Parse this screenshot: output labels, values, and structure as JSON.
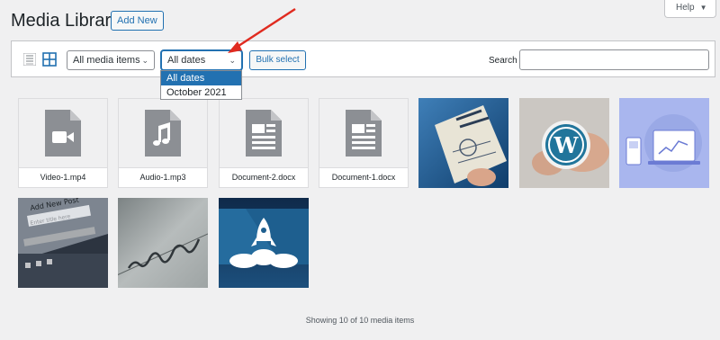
{
  "header": {
    "title": "Media Library",
    "add_new_label": "Add New",
    "help_label": "Help"
  },
  "toolbar": {
    "media_filter": "All media items",
    "date_filter": "All dates",
    "bulk_select_label": "Bulk select",
    "search_label": "Search",
    "search_value": ""
  },
  "date_dropdown": {
    "options": [
      "All dates",
      "October 2021"
    ],
    "selected": "All dates"
  },
  "media": [
    {
      "type": "video",
      "icon": "video-file-icon",
      "filename": "Video-1.mp4"
    },
    {
      "type": "audio",
      "icon": "audio-file-icon",
      "filename": "Audio-1.mp3"
    },
    {
      "type": "document",
      "icon": "document-file-icon",
      "filename": "Document-2.docx"
    },
    {
      "type": "document",
      "icon": "document-file-icon",
      "filename": "Document-1.docx"
    },
    {
      "type": "image",
      "icon": "online-marketing-image",
      "filename": ""
    },
    {
      "type": "image",
      "icon": "wordpress-logo-image",
      "filename": ""
    },
    {
      "type": "image",
      "icon": "devices-analytics-image",
      "filename": ""
    },
    {
      "type": "image",
      "icon": "add-new-post-screenshot-image",
      "filename": ""
    },
    {
      "type": "image",
      "icon": "handwriting-image",
      "filename": ""
    },
    {
      "type": "image",
      "icon": "rocket-launch-image",
      "filename": ""
    }
  ],
  "footer": {
    "count_text": "Showing 10 of 10 media items"
  },
  "colors": {
    "accent": "#2271b1",
    "arrow": "#e02b20",
    "background": "#f0f0f1"
  }
}
